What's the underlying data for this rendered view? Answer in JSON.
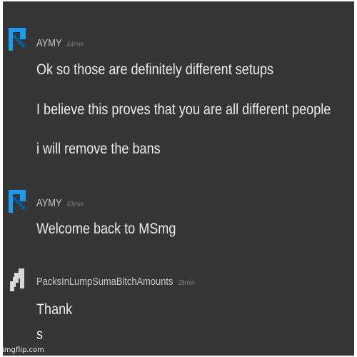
{
  "messages": [
    {
      "username": "AYMY",
      "time": "44min",
      "avatar_icon": "blue-pickaxe-icon",
      "lines": [
        "Ok so those are definitely different setups",
        "I believe this proves that you are all different people",
        "i will remove the bans"
      ]
    },
    {
      "username": "AYMY",
      "time": "43min",
      "avatar_icon": "blue-pickaxe-icon",
      "lines": [
        "Welcome back to MSmg"
      ]
    },
    {
      "username": "PacksInLumpSumaBitchAmounts",
      "time": "28min",
      "avatar_icon": "white-pixel-figure-icon",
      "lines": [
        "Thank",
        "s"
      ]
    }
  ],
  "watermark": "imgflip.com",
  "colors": {
    "background": "#363636",
    "username": "#c7c7c7",
    "message_text": "#ececec",
    "timestamp": "#7c7c7c",
    "pickaxe_blue": "#1b9bf0",
    "pickaxe_dark": "#0f5a9a"
  }
}
